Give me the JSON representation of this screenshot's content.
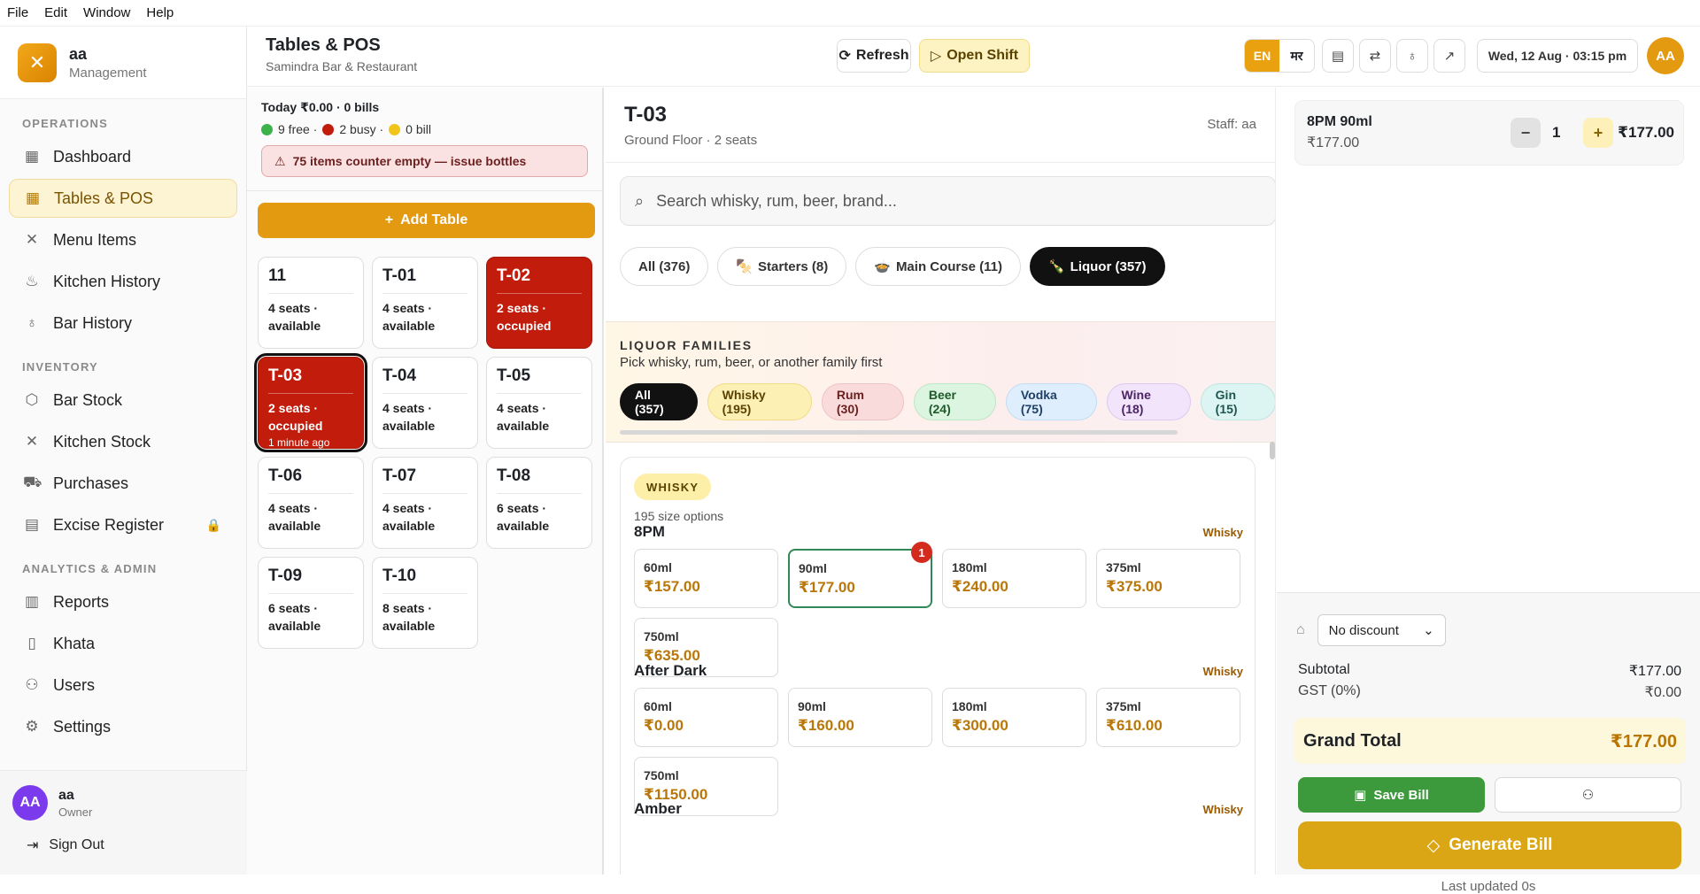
{
  "menubar": [
    "File",
    "Edit",
    "Window",
    "Help"
  ],
  "brand": {
    "name": "aa",
    "sub": "Management"
  },
  "sidebar": {
    "sections": [
      {
        "title": "OPERATIONS",
        "items": [
          {
            "label": "Dashboard",
            "icon": "grid-icon"
          },
          {
            "label": "Tables & POS",
            "icon": "table-icon",
            "active": true
          },
          {
            "label": "Menu Items",
            "icon": "utensils-icon"
          },
          {
            "label": "Kitchen History",
            "icon": "chef-hat-icon"
          },
          {
            "label": "Bar History",
            "icon": "wine-glass-icon"
          }
        ]
      },
      {
        "title": "INVENTORY",
        "items": [
          {
            "label": "Bar Stock",
            "icon": "box-icon"
          },
          {
            "label": "Kitchen Stock",
            "icon": "utensils-icon"
          },
          {
            "label": "Purchases",
            "icon": "cart-icon"
          },
          {
            "label": "Excise Register",
            "icon": "document-icon",
            "locked": true
          }
        ]
      },
      {
        "title": "ANALYTICS & ADMIN",
        "items": [
          {
            "label": "Reports",
            "icon": "bar-chart-icon"
          },
          {
            "label": "Khata",
            "icon": "book-icon"
          },
          {
            "label": "Users",
            "icon": "users-icon"
          },
          {
            "label": "Settings",
            "icon": "gear-icon"
          }
        ]
      }
    ],
    "user": {
      "initials": "AA",
      "name": "aa",
      "role": "Owner"
    },
    "sign_out": "Sign Out"
  },
  "header": {
    "title": "Tables & POS",
    "subtitle": "Samindra Bar & Restaurant",
    "refresh": "Refresh",
    "open_shift": "Open Shift",
    "lang_en": "EN",
    "lang_mr": "मर",
    "date": "Wed, 12 Aug · 03:15 pm",
    "avatar": "AA"
  },
  "tables_panel": {
    "today": "Today ₹0.00 · 0 bills",
    "free": "9 free ·",
    "busy": "2 busy ·",
    "bill": "0 bill",
    "warning": "75 items counter empty — issue bottles",
    "add_table": "Add Table",
    "tables": [
      {
        "name": "11",
        "line1": "4 seats ·",
        "line2": "available",
        "state": "free"
      },
      {
        "name": "T-01",
        "line1": "4 seats ·",
        "line2": "available",
        "state": "free"
      },
      {
        "name": "T-02",
        "line1": "2 seats ·",
        "line2": "occupied",
        "state": "occupied"
      },
      {
        "name": "T-03",
        "line1": "2 seats ·",
        "line2": "occupied",
        "line3": "1 minute ago",
        "state": "occupied",
        "selected": true
      },
      {
        "name": "T-04",
        "line1": "4 seats ·",
        "line2": "available",
        "state": "free"
      },
      {
        "name": "T-05",
        "line1": "4 seats ·",
        "line2": "available",
        "state": "free"
      },
      {
        "name": "T-06",
        "line1": "4 seats ·",
        "line2": "available",
        "state": "free"
      },
      {
        "name": "T-07",
        "line1": "4 seats ·",
        "line2": "available",
        "state": "free"
      },
      {
        "name": "T-08",
        "line1": "6 seats ·",
        "line2": "available",
        "state": "free"
      },
      {
        "name": "T-09",
        "line1": "6 seats ·",
        "line2": "available",
        "state": "free"
      },
      {
        "name": "T-10",
        "line1": "8 seats ·",
        "line2": "available",
        "state": "free"
      }
    ]
  },
  "menu_panel": {
    "table": "T-03",
    "floor": "Ground Floor · 2 seats",
    "staff": "Staff: aa",
    "search_placeholder": "Search whisky, rum, beer, brand...",
    "categories": [
      {
        "label": "All (376)",
        "icon": ""
      },
      {
        "label": "Starters (8)",
        "icon": "🍢"
      },
      {
        "label": "Main Course (11)",
        "icon": "🍲"
      },
      {
        "label": "Liquor (357)",
        "icon": "🍾",
        "active": true
      }
    ],
    "families_title": "LIQUOR FAMILIES",
    "families_sub": "Pick whisky, rum, beer, or another family first",
    "families": [
      {
        "label": "All (357)",
        "bg": "#111111",
        "fg": "#ffffff",
        "border": "#111111"
      },
      {
        "label": "Whisky (195)",
        "bg": "#fdf0b5",
        "fg": "#5a4300",
        "border": "#f1dc8a"
      },
      {
        "label": "Rum (30)",
        "bg": "#fadbdb",
        "fg": "#6b1f1f",
        "border": "#eec3c3"
      },
      {
        "label": "Beer (24)",
        "bg": "#dcf5e0",
        "fg": "#1e5a2a",
        "border": "#bfe6c6"
      },
      {
        "label": "Vodka (75)",
        "bg": "#dfeefc",
        "fg": "#1f3f66",
        "border": "#c3dcf3"
      },
      {
        "label": "Wine (18)",
        "bg": "#f1e4fb",
        "fg": "#4d2466",
        "border": "#dfc9ef"
      },
      {
        "label": "Gin (15)",
        "bg": "#ddf5f2",
        "fg": "#1f5550",
        "border": "#bfe6e0"
      }
    ],
    "family_badge": "WHISKY",
    "family_sub": "195 size options",
    "brands": [
      {
        "name": "8PM",
        "tag": "Whisky",
        "sizes": [
          {
            "size": "60ml",
            "price": "₹157.00"
          },
          {
            "size": "90ml",
            "price": "₹177.00",
            "selected": true,
            "count": "1"
          },
          {
            "size": "180ml",
            "price": "₹240.00"
          },
          {
            "size": "375ml",
            "price": "₹375.00"
          },
          {
            "size": "750ml",
            "price": "₹635.00"
          }
        ]
      },
      {
        "name": "After Dark",
        "tag": "Whisky",
        "sizes": [
          {
            "size": "60ml",
            "price": "₹0.00"
          },
          {
            "size": "90ml",
            "price": "₹160.00"
          },
          {
            "size": "180ml",
            "price": "₹300.00"
          },
          {
            "size": "375ml",
            "price": "₹610.00"
          },
          {
            "size": "750ml",
            "price": "₹1150.00"
          }
        ]
      },
      {
        "name": "Amber",
        "tag": "Whisky",
        "sizes": []
      }
    ]
  },
  "order": {
    "item": {
      "name": "8PM 90ml",
      "price": "₹177.00",
      "qty": "1",
      "total": "₹177.00"
    },
    "discount": "No discount",
    "subtotal_label": "Subtotal",
    "subtotal": "₹177.00",
    "gst_label": "GST (0%)",
    "gst": "₹0.00",
    "grand_label": "Grand Total",
    "grand": "₹177.00",
    "save": "Save Bill",
    "generate": "Generate Bill",
    "updated": "Last updated 0s"
  },
  "colors": {
    "accent": "#e39a10",
    "occupied": "#c21d0c",
    "free": "#3cb34a",
    "busy": "#c21d0c",
    "bill": "#f0c419",
    "save": "#3c9a3c"
  }
}
